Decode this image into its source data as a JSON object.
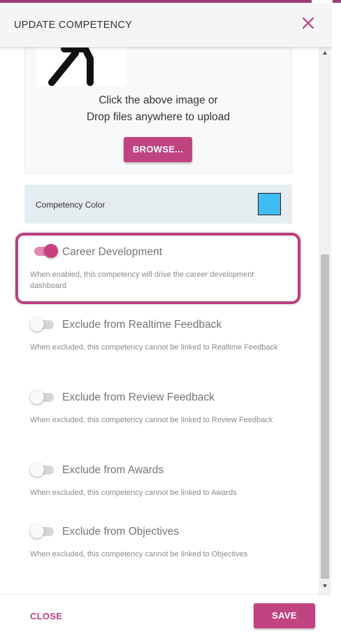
{
  "dialog": {
    "title": "UPDATE COMPETENCY",
    "close_icon": "close-icon"
  },
  "upload": {
    "line1": "Click the above image or",
    "line2": "Drop files anywhere to upload",
    "browse_label": "BROWSE..."
  },
  "color": {
    "label": "Competency Color",
    "value": "#3ebdf2"
  },
  "options": [
    {
      "label": "Career Development",
      "description": "When enabled, this competency will drive the career development dashboard",
      "enabled": true
    },
    {
      "label": "Exclude from Realtime Feedback",
      "description": "When excluded, this competency cannot be linked to Realtime Feedback",
      "enabled": false
    },
    {
      "label": "Exclude from Review Feedback",
      "description": "When excluded, this competency cannot be linked to Review Feedback",
      "enabled": false
    },
    {
      "label": "Exclude from Awards",
      "description": "When excluded, this competency cannot be linked to Awards",
      "enabled": false
    },
    {
      "label": "Exclude from Objectives",
      "description": "When excluded, this competency cannot be linked to Objectives",
      "enabled": false
    }
  ],
  "footer": {
    "close_label": "CLOSE",
    "save_label": "SAVE"
  },
  "colors": {
    "accent": "#c04480",
    "toggle_on_track": "#e08ab3",
    "highlight_border": "#b83f7d"
  }
}
